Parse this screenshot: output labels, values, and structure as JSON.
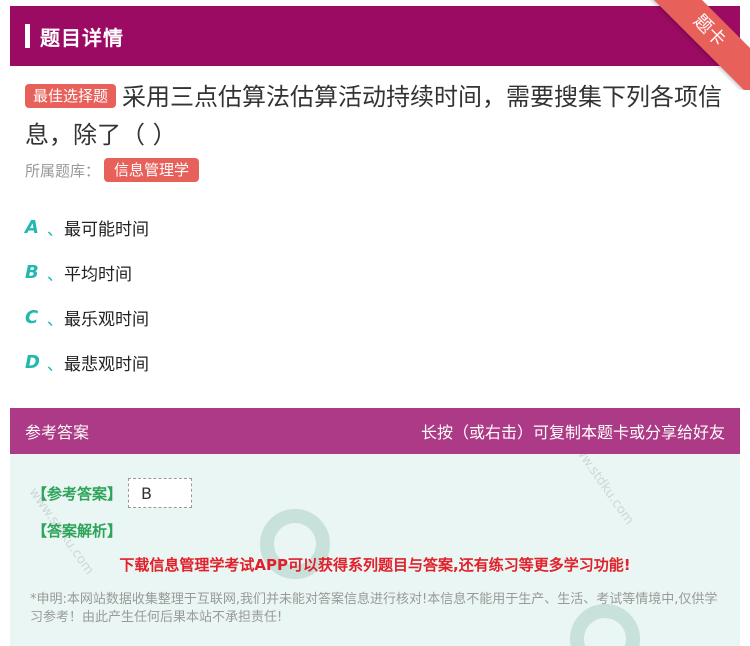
{
  "header": {
    "title": "题目详情",
    "ribbon_label": "题卡"
  },
  "question": {
    "badge": "最佳选择题",
    "text": "采用三点估算法估算活动持续时间，需要搜集下列各项信息，除了（ ）"
  },
  "bank": {
    "label": "所属题库：",
    "tag": "信息管理学"
  },
  "options": [
    {
      "letter": "A",
      "sep": "、",
      "text": "最可能时间"
    },
    {
      "letter": "B",
      "sep": "、",
      "text": "平均时间"
    },
    {
      "letter": "C",
      "sep": "、",
      "text": "最乐观时间"
    },
    {
      "letter": "D",
      "sep": "、",
      "text": "最悲观时间"
    }
  ],
  "answer_header": {
    "left": "参考答案",
    "right": "长按（或右击）可复制本题卡或分享给好友"
  },
  "answer": {
    "label": "【参考答案】",
    "value": "B",
    "analysis_label": "【答案解析】",
    "promo": "下载信息管理学考试APP可以获得系列题目与答案,还有练习等更多学习功能!",
    "disclaimer": "*申明:本网站数据收集整理于互联网,我们并未能对答案信息进行核对!本信息不能用于生产、生活、考试等情境中,仅供学习参考！由此产生任何后果本站不承担责任!"
  },
  "colors": {
    "header_bg": "#9b0a63",
    "accent_red": "#e8605a",
    "option_teal": "#22b8b0",
    "answer_header_bg": "#ad3a86",
    "answer_green": "#2ea35a",
    "promo_red": "#e0202a"
  }
}
